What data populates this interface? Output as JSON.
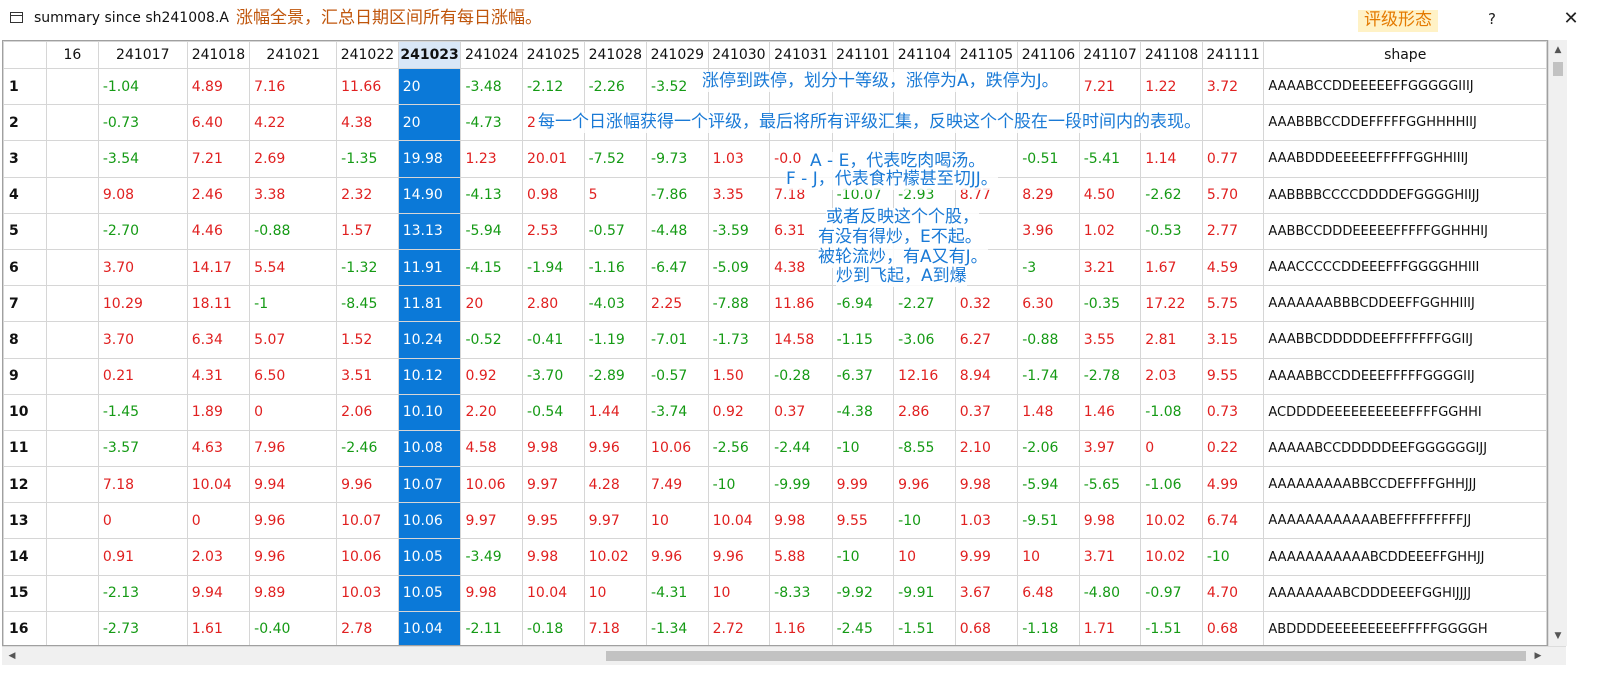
{
  "window": {
    "title": "summary since sh241008.A",
    "help_label": "?",
    "close_label": "✕",
    "icon": "window-icon"
  },
  "annotations": {
    "top_note": "涨幅全景，汇总日期区间所有每日涨幅。",
    "top_right": "评级形态",
    "line1": "涨停到跌停，划分十等级，涨停为A，跌停为J。",
    "line2": "每一个日涨幅获得一个评级，最后将所有评级汇集，反映这个个股在一段时间内的表现。",
    "line3a": "A - E，代表吃肉喝汤。",
    "line3b": "F - J，代表食柠檬甚至切JJ。",
    "line4a": "或者反映这个个股，",
    "line4b": "有没有得炒，E不起。",
    "line4c": "被轮流炒，有A又有J。",
    "line4d": "炒到飞起，A到爆"
  },
  "table": {
    "columns": [
      "16",
      "241017",
      "241018",
      "241021",
      "241022",
      "241023",
      "241024",
      "241025",
      "241028",
      "241029",
      "241030",
      "241031",
      "241101",
      "241104",
      "241105",
      "241106",
      "241107",
      "241108",
      "241111",
      "shape"
    ],
    "selected_column": "241023",
    "rows": [
      {
        "num": "1",
        "cells": [
          "",
          "-1.04",
          "4.89",
          "7.16",
          "11.66",
          "20",
          "-3.48",
          "-2.12",
          "-2.26",
          "-3.52",
          "",
          "",
          "",
          "",
          "",
          "",
          "7.21",
          "1.22",
          "3.72"
        ],
        "shape": "AAAABCCDDEEEEEFFGGGGGIIIJ"
      },
      {
        "num": "2",
        "cells": [
          "",
          "-0.73",
          "6.40",
          "4.22",
          "4.38",
          "20",
          "-4.73",
          "2",
          "",
          "",
          "",
          "",
          "",
          "",
          "",
          "",
          "",
          "",
          ""
        ],
        "shape": "AAABBBCCDDEFFFFFGGHHHHIIJ"
      },
      {
        "num": "3",
        "cells": [
          "",
          "-3.54",
          "7.21",
          "2.69",
          "-1.35",
          "19.98",
          "1.23",
          "20.01",
          "-7.52",
          "-9.73",
          "1.03",
          "-0.0",
          "",
          "",
          "",
          "-0.51",
          "-5.41",
          "1.14",
          "0.77"
        ],
        "shape": "AAABDDDEEEEEFFFFFGGHHIIIJ"
      },
      {
        "num": "4",
        "cells": [
          "",
          "9.08",
          "2.46",
          "3.38",
          "2.32",
          "14.90",
          "-4.13",
          "0.98",
          "5",
          "-7.86",
          "3.35",
          "7.18",
          "-10.07",
          "-2.93",
          "8.77",
          "8.29",
          "4.50",
          "-2.62",
          "5.70"
        ],
        "shape": "AABBBBCCCCDDDDEFGGGGHIIJJ"
      },
      {
        "num": "5",
        "cells": [
          "",
          "-2.70",
          "4.46",
          "-0.88",
          "1.57",
          "13.13",
          "-5.94",
          "2.53",
          "-0.57",
          "-4.48",
          "-3.59",
          "6.31",
          "",
          "",
          "",
          "3.96",
          "1.02",
          "-0.53",
          "2.77"
        ],
        "shape": "AABBCCDDDEEEEEFFFFFGGHHHIJ"
      },
      {
        "num": "6",
        "cells": [
          "",
          "3.70",
          "14.17",
          "5.54",
          "-1.32",
          "11.91",
          "-4.15",
          "-1.94",
          "-1.16",
          "-6.47",
          "-5.09",
          "4.38",
          "",
          "",
          "",
          "-3",
          "3.21",
          "1.67",
          "4.59"
        ],
        "shape": "AAACCCCCDDEEEFFFGGGGHHIII"
      },
      {
        "num": "7",
        "cells": [
          "",
          "10.29",
          "18.11",
          "-1",
          "-8.45",
          "11.81",
          "20",
          "2.80",
          "-4.03",
          "2.25",
          "-7.88",
          "11.86",
          "-6.94",
          "-2.27",
          "0.32",
          "6.30",
          "-0.35",
          "17.22",
          "5.75"
        ],
        "shape": "AAAAAAABBBCDDEEFFGGHHIIIJ"
      },
      {
        "num": "8",
        "cells": [
          "",
          "3.70",
          "6.34",
          "5.07",
          "1.52",
          "10.24",
          "-0.52",
          "-0.41",
          "-1.19",
          "-7.01",
          "-1.73",
          "14.58",
          "-1.15",
          "-3.06",
          "6.27",
          "-0.88",
          "3.55",
          "2.81",
          "3.15"
        ],
        "shape": "AAABBCDDDDDEEFFFFFFFGGIIJ"
      },
      {
        "num": "9",
        "cells": [
          "",
          "0.21",
          "4.31",
          "6.50",
          "3.51",
          "10.12",
          "0.92",
          "-3.70",
          "-2.89",
          "-0.57",
          "1.50",
          "-0.28",
          "-6.37",
          "12.16",
          "8.94",
          "-1.74",
          "-2.78",
          "2.03",
          "9.55"
        ],
        "shape": "AAAABBCCDDEEEFFFFFGGGGIIJ"
      },
      {
        "num": "10",
        "cells": [
          "",
          "-1.45",
          "1.89",
          "0",
          "2.06",
          "10.10",
          "2.20",
          "-0.54",
          "1.44",
          "-3.74",
          "0.92",
          "0.37",
          "-4.38",
          "2.86",
          "0.37",
          "1.48",
          "1.46",
          "-1.08",
          "0.73"
        ],
        "shape": "ACDDDDEEEEEEEEEEFFFFGGHHI"
      },
      {
        "num": "11",
        "cells": [
          "",
          "-3.57",
          "4.63",
          "7.96",
          "-2.46",
          "10.08",
          "4.58",
          "9.98",
          "9.96",
          "10.06",
          "-2.56",
          "-2.44",
          "-10",
          "-8.55",
          "2.10",
          "-2.06",
          "3.97",
          "0",
          "0.22"
        ],
        "shape": "AAAAABCCDDDDDEEFGGGGGGIJJ"
      },
      {
        "num": "12",
        "cells": [
          "",
          "7.18",
          "10.04",
          "9.94",
          "9.96",
          "10.07",
          "10.06",
          "9.97",
          "4.28",
          "7.49",
          "-10",
          "-9.99",
          "9.99",
          "9.96",
          "9.98",
          "-5.94",
          "-5.65",
          "-1.06",
          "4.99"
        ],
        "shape": "AAAAAAAAABBCCDEFFFFGHHJJJ"
      },
      {
        "num": "13",
        "cells": [
          "",
          "0",
          "0",
          "9.96",
          "10.07",
          "10.06",
          "9.97",
          "9.95",
          "9.97",
          "10",
          "10.04",
          "9.98",
          "9.55",
          "-10",
          "1.03",
          "-9.51",
          "9.98",
          "10.02",
          "6.74"
        ],
        "shape": "AAAAAAAAAAAABEFFFFFFFFFJJ"
      },
      {
        "num": "14",
        "cells": [
          "",
          "0.91",
          "2.03",
          "9.96",
          "10.06",
          "10.05",
          "-3.49",
          "9.98",
          "10.02",
          "9.96",
          "9.96",
          "5.88",
          "-10",
          "10",
          "9.99",
          "10",
          "3.71",
          "10.02",
          "-10"
        ],
        "shape": "AAAAAAAAAAABCDDEEEFFGHHJJ"
      },
      {
        "num": "15",
        "cells": [
          "",
          "-2.13",
          "9.94",
          "9.89",
          "10.03",
          "10.05",
          "9.98",
          "10.04",
          "10",
          "-4.31",
          "10",
          "-8.33",
          "-9.92",
          "-9.91",
          "3.67",
          "6.48",
          "-4.80",
          "-0.97",
          "4.70"
        ],
        "shape": "AAAAAAAABCDDDEEEFGGHIJJJJ"
      },
      {
        "num": "16",
        "cells": [
          "",
          "-2.73",
          "1.61",
          "-0.40",
          "2.78",
          "10.04",
          "-2.11",
          "-0.18",
          "7.18",
          "-1.34",
          "2.72",
          "1.16",
          "-2.45",
          "-1.51",
          "0.68",
          "-1.18",
          "1.71",
          "-1.51",
          "0.68"
        ],
        "shape": "ABDDDDEEEEEEEEEFFFFFGGGGH"
      }
    ]
  },
  "colors": {
    "positive": "#e02020",
    "negative": "#159a15",
    "selected_bg": "#0b79d8",
    "annotation_blue": "#1a7ad6",
    "annotation_orange": "#e47a00"
  },
  "scrollbars": {
    "up_icon": "arrow-up-icon",
    "down_icon": "arrow-down-icon",
    "left_icon": "arrow-left-icon",
    "right_icon": "arrow-right-icon"
  }
}
